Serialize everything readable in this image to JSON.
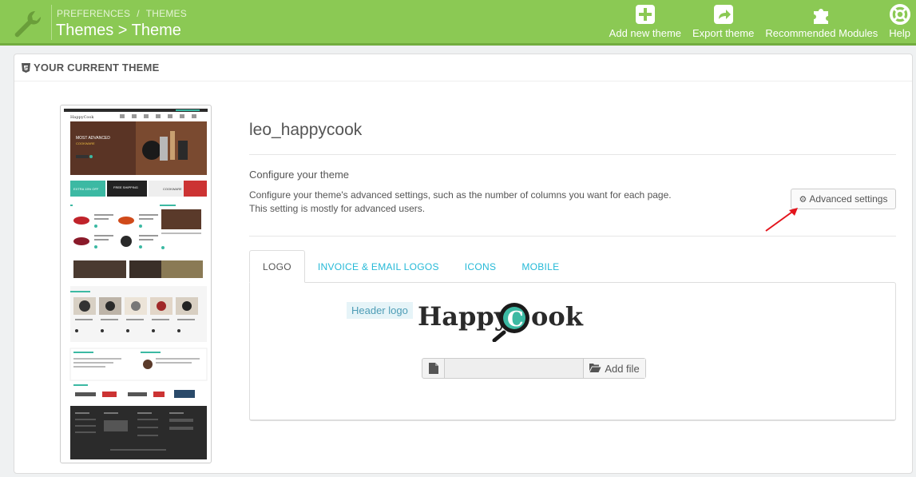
{
  "header": {
    "breadcrumb": [
      "PREFERENCES",
      "THEMES"
    ],
    "breadcrumb_sep": "/",
    "title": "Themes > Theme",
    "bar_color": "#8bc954",
    "actions": [
      {
        "label": "Add new theme",
        "icon": "plus-square-icon"
      },
      {
        "label": "Export theme",
        "icon": "share-icon"
      },
      {
        "label": "Recommended Modules",
        "icon": "puzzle-icon"
      },
      {
        "label": "Help",
        "icon": "lifebuoy-icon"
      }
    ]
  },
  "panel": {
    "heading": "YOUR CURRENT THEME",
    "heading_icon": "html5-icon"
  },
  "theme": {
    "name": "leo_happycook",
    "configure_title": "Configure your theme",
    "configure_desc": "Configure your theme's advanced settings, such as the number of columns you want for each page. This setting is mostly for advanced users.",
    "advanced_button": "Advanced settings"
  },
  "tabs": [
    {
      "label": "LOGO",
      "active": true
    },
    {
      "label": "INVOICE & EMAIL LOGOS",
      "active": false
    },
    {
      "label": "ICONS",
      "active": false
    },
    {
      "label": "MOBILE",
      "active": false
    }
  ],
  "logo_tab": {
    "label": "Header logo",
    "logo_text_pre": "Happy",
    "logo_text_letter": "C",
    "logo_text_post": "ook",
    "add_file": "Add file",
    "file_value": ""
  },
  "thumbnail": {
    "hero_line1": "MOST ADVANCED",
    "hero_line2": "COOKWARE",
    "banner1": "EXTRA 15% OFF",
    "banner2": "FREE SHIPPING",
    "banner3": "COOKWARE",
    "accent": "#3cb9a3"
  },
  "colors": {
    "link": "#25b9d7",
    "arrow": "#e3141c"
  }
}
